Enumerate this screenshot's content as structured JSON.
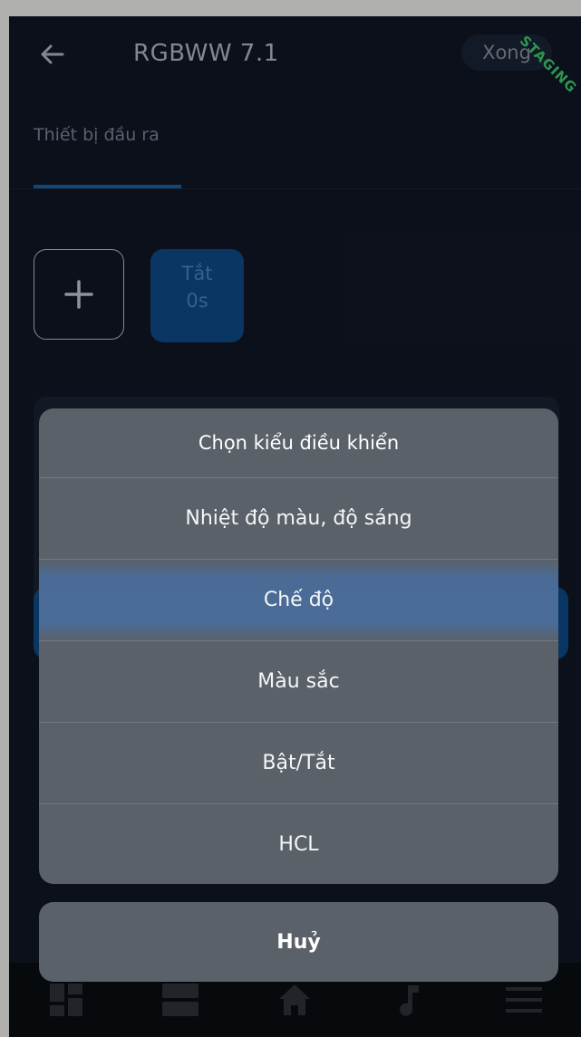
{
  "header": {
    "back_icon": "arrow-left-icon",
    "title": "RGBWW 7.1",
    "done_label": "Xong",
    "staging_label": "STAGING"
  },
  "tabs": [
    {
      "label": "Thiết bị đầu ra",
      "active": true
    }
  ],
  "scenes": {
    "add_icon": "plus-icon",
    "tile": {
      "state": "Tắt",
      "duration": "0s"
    }
  },
  "action_sheet": {
    "title": "Chọn kiểu điều khiển",
    "options": [
      {
        "label": "Nhiệt độ màu, độ sáng"
      },
      {
        "label": "Chế độ",
        "highlighted": true
      },
      {
        "label": "Màu sắc"
      },
      {
        "label": "Bật/Tắt"
      },
      {
        "label": "HCL"
      }
    ],
    "cancel_label": "Huỷ"
  },
  "bottom_nav": {
    "items": [
      "dashboard-icon",
      "rooms-icon",
      "home-icon",
      "music-icon",
      "menu-icon"
    ]
  },
  "colors": {
    "accent": "#1a63a8",
    "sheet_bg": "#5a6169",
    "highlight": "#4b6c98",
    "staging": "#3fd06e"
  }
}
